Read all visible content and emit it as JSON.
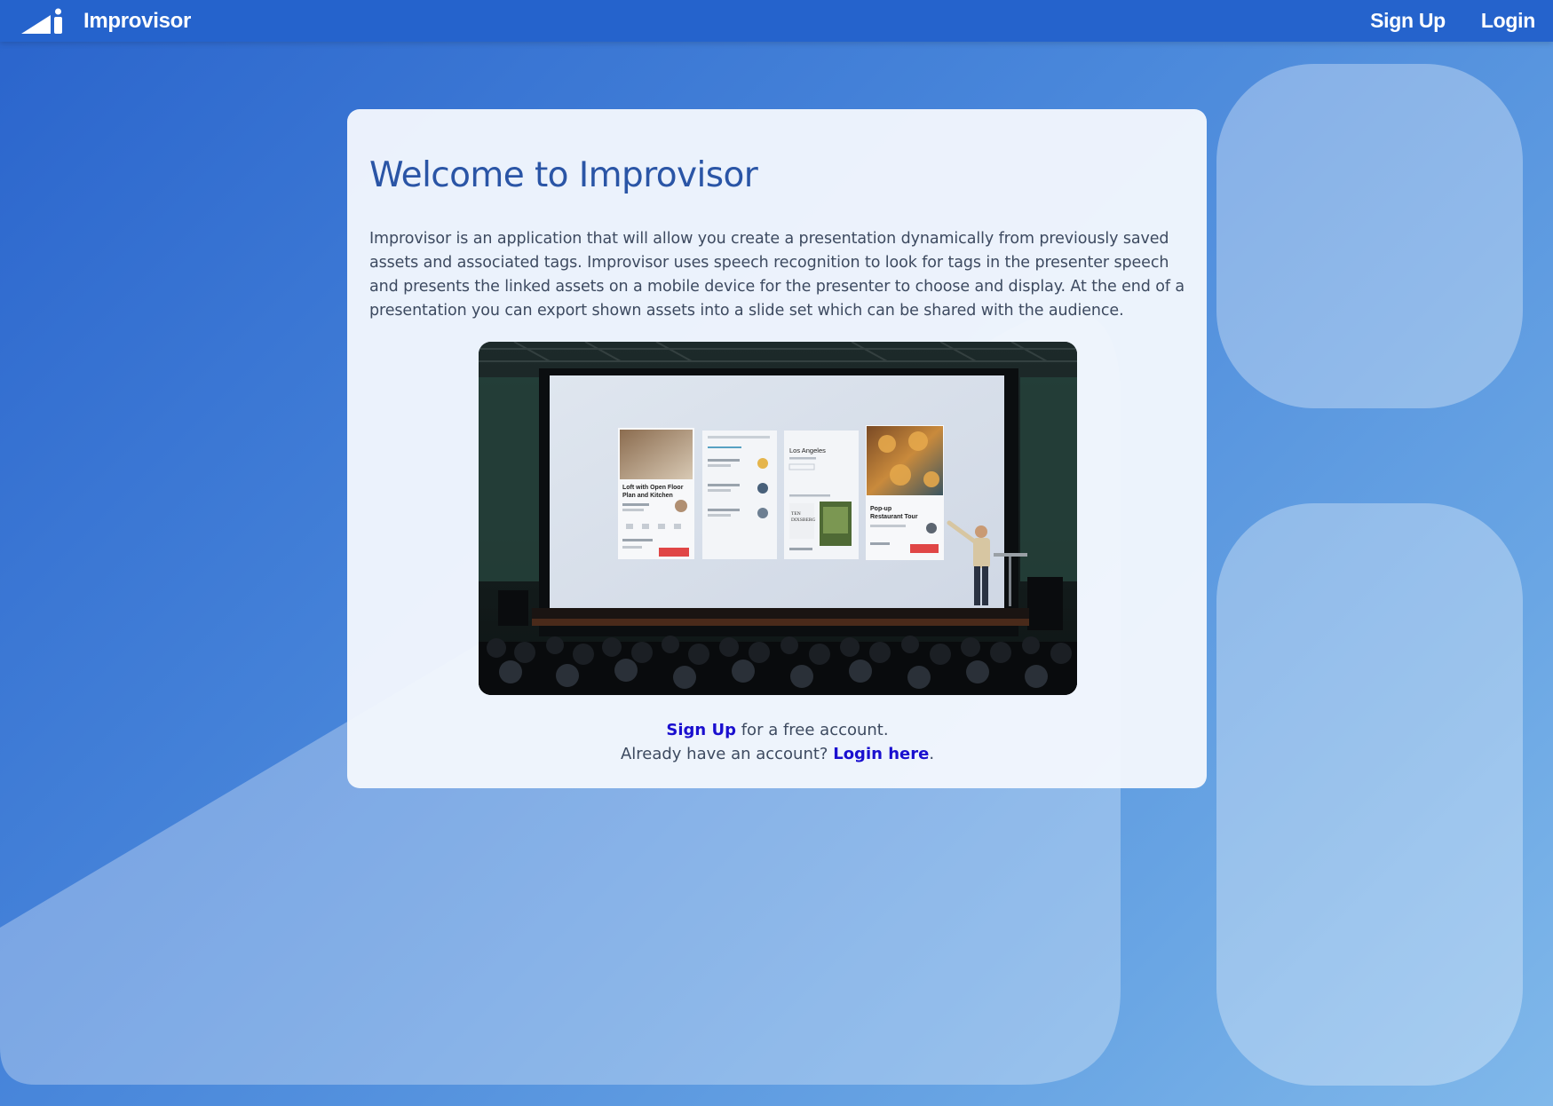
{
  "navbar": {
    "brand_name": "Improvisor",
    "brand_icon": "signal-bars-logo",
    "signup_label": "Sign Up",
    "login_label": "Login"
  },
  "main": {
    "title": "Welcome to Improvisor",
    "intro": "Improvisor is an application that will allow you create a presentation dynamically from previously saved assets and associated tags. Improvisor uses speech recognition to look for tags in the presenter speech and presents the linked assets on a mobile device for the presenter to choose and display. At the end of a presentation you can export shown assets into a slide set which can be shared with the audience.",
    "image_alt": "Presenter on stage in front of a large projection screen",
    "screen": {
      "panel1_title": "Loft with Open Floor Plan and Kitchen",
      "panel3_title": "Los Angeles",
      "panel4_title": "Pop-up Restaurant Tour"
    },
    "cta": {
      "signup_link": "Sign Up",
      "signup_suffix": " for a free account.",
      "login_prefix": "Already have an account? ",
      "login_link": "Login here",
      "login_suffix": "."
    }
  },
  "colors": {
    "navbar": "#2563cc",
    "title": "#2a55a6",
    "link": "#1a0fcf",
    "body_text": "#3d4a60"
  }
}
